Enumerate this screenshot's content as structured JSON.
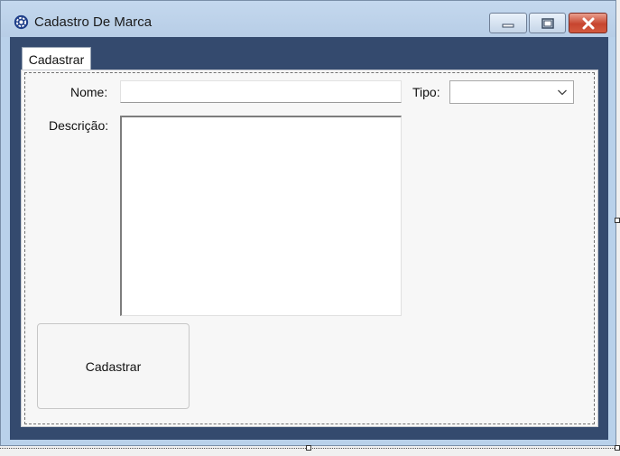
{
  "window": {
    "title": "Cadastro De Marca",
    "icon": "gear-icon"
  },
  "controls": {
    "minimize": "minimize-icon",
    "maximize": "maximize-icon",
    "close": "close-icon"
  },
  "tabs": [
    {
      "label": "Cadastrar"
    }
  ],
  "form": {
    "nome_label": "Nome:",
    "nome_value": "",
    "tipo_label": "Tipo:",
    "tipo_value": "",
    "descricao_label": "Descrição:",
    "descricao_value": "",
    "submit_label": "Cadastrar"
  },
  "colors": {
    "title_bar": "#b9d1ea",
    "client_background": "#344a6e",
    "close_button": "#c7452f"
  }
}
